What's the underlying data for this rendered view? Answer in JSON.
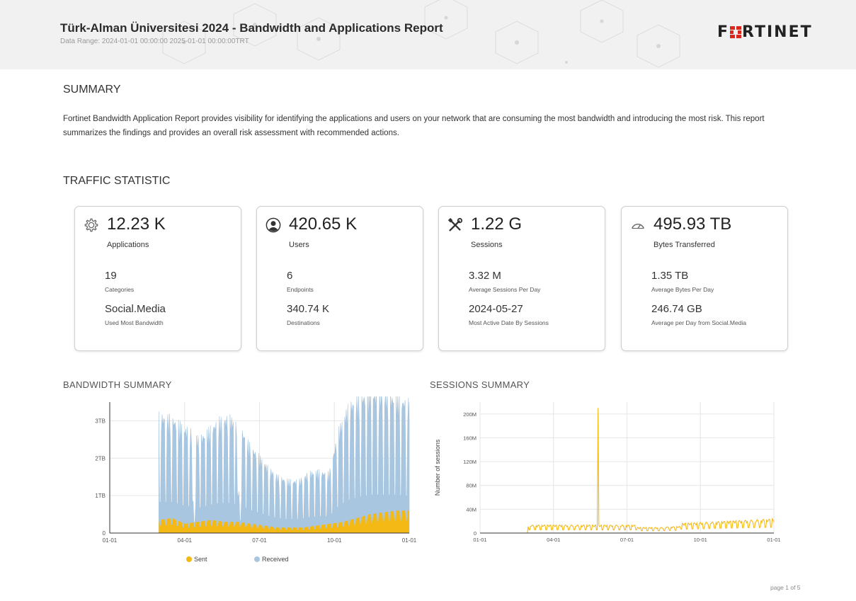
{
  "header": {
    "title": "Türk-Alman Üniversitesi 2024 - Bandwidth and Applications Report",
    "data_range": "Data Range: 2024-01-01 00:00:00 2025-01-01 00:00:00TRT",
    "logo_text_left": "F",
    "logo_text_right": "RTINET"
  },
  "summary": {
    "heading": "SUMMARY",
    "text": "Fortinet Bandwidth Application Report provides visibility for identifying the applications and users on your network that are consuming the most bandwidth and introducing the most risk. This report summarizes the findings and provides an overall risk assessment with recommended actions."
  },
  "traffic": {
    "heading": "TRAFFIC STATISTIC",
    "cards": [
      {
        "icon": "gear-icon",
        "value": "12.23 K",
        "label": "Applications",
        "sub1_value": "19",
        "sub1_label": "Categories",
        "sub2_value": "Social.Media",
        "sub2_label": "Used Most Bandwidth"
      },
      {
        "icon": "user-icon",
        "value": "420.65 K",
        "label": "Users",
        "sub1_value": "6",
        "sub1_label": "Endpoints",
        "sub2_value": "340.74 K",
        "sub2_label": "Destinations"
      },
      {
        "icon": "tools-icon",
        "value": "1.22 G",
        "label": "Sessions",
        "sub1_value": "3.32 M",
        "sub1_label": "Average Sessions Per Day",
        "sub2_value": "2024-05-27",
        "sub2_label": "Most Active Date By Sessions"
      },
      {
        "icon": "speedometer-icon",
        "value": "495.93 TB",
        "label": "Bytes Transferred",
        "sub1_value": "1.35 TB",
        "sub1_label": "Average Bytes Per Day",
        "sub2_value": "246.74 GB",
        "sub2_label": "Average per Day from Social.Media"
      }
    ]
  },
  "bandwidth_chart_title": "BANDWIDTH SUMMARY",
  "sessions_chart_title": "SESSIONS SUMMARY",
  "chart_data": [
    {
      "type": "area",
      "title": "BANDWIDTH SUMMARY",
      "x_ticks": [
        "01-01",
        "04-01",
        "07-01",
        "10-01",
        "01-01"
      ],
      "y_ticks": [
        "0",
        "1TB",
        "2TB",
        "3TB"
      ],
      "y_unit": "TB",
      "ylim": [
        0,
        3.5
      ],
      "data_start": "2024-03-01",
      "legend": [
        "Sent",
        "Received"
      ],
      "legend_position": "bottom",
      "grid": true,
      "colors": {
        "sent": "#f4b914",
        "received": "#a9c6e0"
      },
      "series": [
        {
          "name": "Received",
          "approx_weekday_peak_TB": [
            2.9,
            2.8,
            2.7,
            2.6,
            2.3,
            2.5,
            2.8,
            2.9,
            2.7,
            2.2,
            1.9,
            1.6,
            1.4,
            1.3,
            1.3,
            1.5,
            1.5,
            1.4,
            2.6,
            3.2,
            3.3,
            3.4,
            3.3,
            3.2,
            3.1,
            3.0
          ]
        },
        {
          "name": "Sent",
          "approx_level_TB": [
            0.35,
            0.4,
            0.25,
            0.3,
            0.35,
            0.3,
            0.3,
            0.25,
            0.2,
            0.15,
            0.15,
            0.15,
            0.2,
            0.25,
            0.3,
            0.4,
            0.5,
            0.55,
            0.6,
            0.6
          ]
        }
      ]
    },
    {
      "type": "line",
      "title": "SESSIONS SUMMARY",
      "x_ticks": [
        "01-01",
        "04-01",
        "07-01",
        "10-01",
        "01-01"
      ],
      "y_ticks": [
        "0",
        "40M",
        "80M",
        "120M",
        "160M",
        "200M"
      ],
      "ylabel": "Number of sessions",
      "ylim": [
        0,
        220000000
      ],
      "grid": true,
      "color": "#f4b914",
      "series": [
        {
          "name": "Sessions",
          "peak": {
            "date": "2024-05-27",
            "value": 210000000
          },
          "typical_range": [
            5000000,
            20000000
          ]
        }
      ]
    }
  ],
  "footer": {
    "page": "page 1 of 5"
  }
}
